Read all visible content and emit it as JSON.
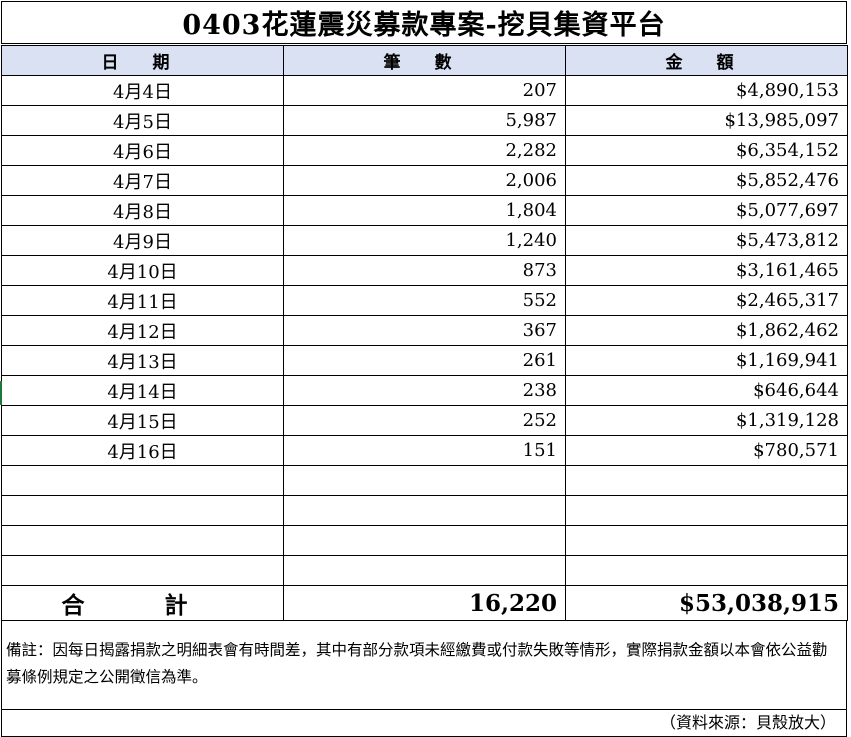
{
  "title": "0403花蓮震災募款專案-挖貝集資平台",
  "headers": {
    "date": "日 期",
    "count": "筆 數",
    "amount": "金 額"
  },
  "rows": [
    {
      "date": "4月4日",
      "count": "207",
      "amount": "$4,890,153"
    },
    {
      "date": "4月5日",
      "count": "5,987",
      "amount": "$13,985,097"
    },
    {
      "date": "4月6日",
      "count": "2,282",
      "amount": "$6,354,152"
    },
    {
      "date": "4月7日",
      "count": "2,006",
      "amount": "$5,852,476"
    },
    {
      "date": "4月8日",
      "count": "1,804",
      "amount": "$5,077,697"
    },
    {
      "date": "4月9日",
      "count": "1,240",
      "amount": "$5,473,812"
    },
    {
      "date": "4月10日",
      "count": "873",
      "amount": "$3,161,465"
    },
    {
      "date": "4月11日",
      "count": "552",
      "amount": "$2,465,317"
    },
    {
      "date": "4月12日",
      "count": "367",
      "amount": "$1,862,462"
    },
    {
      "date": "4月13日",
      "count": "261",
      "amount": "$1,169,941"
    },
    {
      "date": "4月14日",
      "count": "238",
      "amount": "$646,644"
    },
    {
      "date": "4月15日",
      "count": "252",
      "amount": "$1,319,128"
    },
    {
      "date": "4月16日",
      "count": "151",
      "amount": "$780,571"
    }
  ],
  "total": {
    "label": "合 計",
    "count": "16,220",
    "amount": "$53,038,915"
  },
  "note": "備註：因每日揭露捐款之明細表會有時間差，其中有部分款項未經繳費或付款失敗等情形，實際捐款金額以本會依公益勸募條例規定之公開徵信為準。",
  "source": "（資料來源：貝殼放大）"
}
